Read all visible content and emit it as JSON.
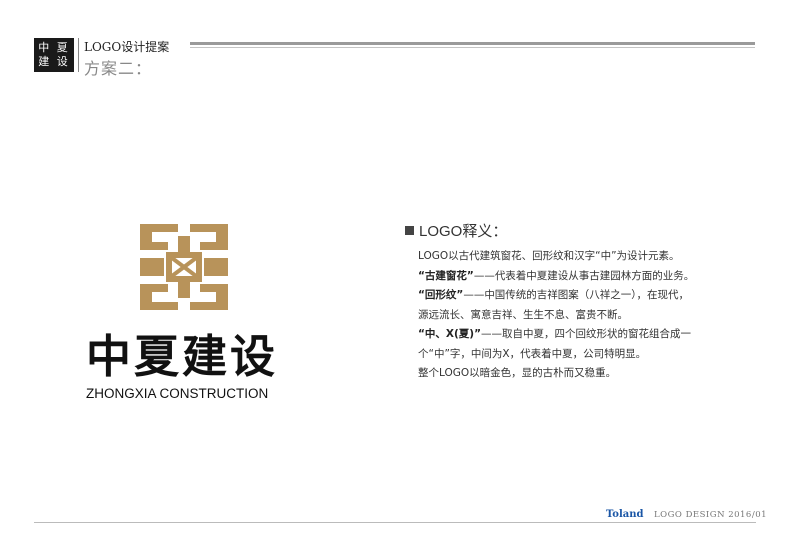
{
  "header": {
    "badge_line1": "中 夏",
    "badge_line2": "建 设",
    "title": "LOGO设计提案",
    "subtitle": "方案二："
  },
  "logo": {
    "name_cn": "中夏建设",
    "name_en": "ZHONGXIA CONSTRUCTION",
    "mark_color": "#B8935A"
  },
  "description": {
    "heading": "LOGO释义：",
    "line1": "LOGO以古代建筑窗花、回形纹和汉字“中”为设计元素。",
    "line2_key": "“古建窗花”",
    "line2_text": "——代表着中夏建设从事古建园林方面的业务。",
    "line3_key": "“回形纹”",
    "line3_text": "——中国传统的吉祥图案（八祥之一），在现代，",
    "line4": "源远流长、寓意吉祥、生生不息、富贵不断。",
    "line5_key": "“中、X(夏)”",
    "line5_text": "——取自中夏，四个回纹形状的窗花组合成一",
    "line6": "个“中”字，中间为X，代表着中夏，公司特明显。",
    "line7": "整个LOGO以暗金色，显的古朴而又稳重。"
  },
  "footer": {
    "brand": "Toland",
    "text": "LOGO DESIGN  2016/01"
  }
}
